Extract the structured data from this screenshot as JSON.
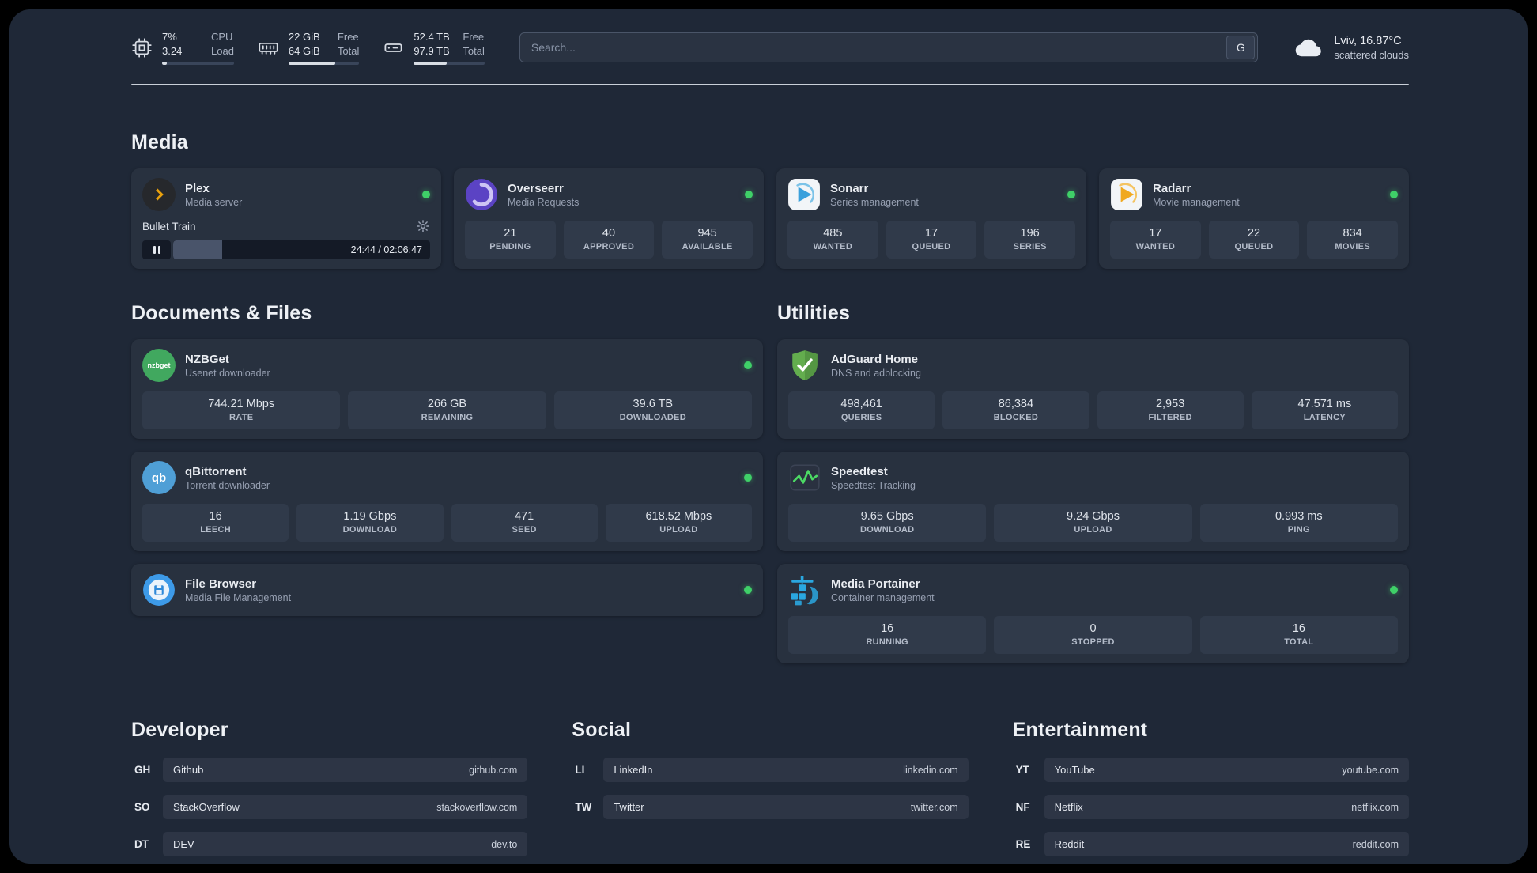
{
  "colors": {
    "status_online": "#3fd068",
    "accent_plex": "#e8a00d",
    "accent_sonarr": "#3aa0dc",
    "accent_radarr": "#f0a91f",
    "accent_adguard": "#63ad4e",
    "accent_speedtest": "#4cd964",
    "accent_portainer": "#2aa7e0"
  },
  "topbar": {
    "cpu": {
      "usage": "7%",
      "load": "3.24",
      "label_line1": "CPU",
      "label_line2": "Load",
      "percent": 7
    },
    "ram": {
      "free": "22 GiB",
      "total": "64 GiB",
      "label_line1": "Free",
      "label_line2": "Total",
      "percent": 66
    },
    "disk": {
      "free": "52.4 TB",
      "total": "97.9 TB",
      "label_line1": "Free",
      "label_line2": "Total",
      "percent": 47
    },
    "search": {
      "placeholder": "Search...",
      "button_label": "G"
    },
    "weather": {
      "location": "Lviv, 16.87°C",
      "condition": "scattered clouds"
    }
  },
  "media": {
    "section_title": "Media",
    "plex": {
      "title": "Plex",
      "subtitle": "Media server",
      "now_playing": "Bullet Train",
      "time_display": "24:44 / 02:06:47",
      "progress_percent": 19
    },
    "overseerr": {
      "title": "Overseerr",
      "subtitle": "Media Requests",
      "stats": [
        {
          "value": "21",
          "label": "PENDING"
        },
        {
          "value": "40",
          "label": "APPROVED"
        },
        {
          "value": "945",
          "label": "AVAILABLE"
        }
      ]
    },
    "sonarr": {
      "title": "Sonarr",
      "subtitle": "Series management",
      "stats": [
        {
          "value": "485",
          "label": "WANTED"
        },
        {
          "value": "17",
          "label": "QUEUED"
        },
        {
          "value": "196",
          "label": "SERIES"
        }
      ]
    },
    "radarr": {
      "title": "Radarr",
      "subtitle": "Movie management",
      "stats": [
        {
          "value": "17",
          "label": "WANTED"
        },
        {
          "value": "22",
          "label": "QUEUED"
        },
        {
          "value": "834",
          "label": "MOVIES"
        }
      ]
    }
  },
  "documents": {
    "section_title": "Documents & Files",
    "nzbget": {
      "title": "NZBGet",
      "subtitle": "Usenet downloader",
      "icon_text": "nzbget",
      "stats": [
        {
          "value": "744.21 Mbps",
          "label": "RATE"
        },
        {
          "value": "266 GB",
          "label": "REMAINING"
        },
        {
          "value": "39.6 TB",
          "label": "DOWNLOADED"
        }
      ]
    },
    "qbittorrent": {
      "title": "qBittorrent",
      "subtitle": "Torrent downloader",
      "icon_text": "qb",
      "stats": [
        {
          "value": "16",
          "label": "LEECH"
        },
        {
          "value": "1.19 Gbps",
          "label": "DOWNLOAD"
        },
        {
          "value": "471",
          "label": "SEED"
        },
        {
          "value": "618.52 Mbps",
          "label": "UPLOAD"
        }
      ]
    },
    "filebrowser": {
      "title": "File Browser",
      "subtitle": "Media File Management"
    }
  },
  "utilities": {
    "section_title": "Utilities",
    "adguard": {
      "title": "AdGuard Home",
      "subtitle": "DNS and adblocking",
      "stats": [
        {
          "value": "498,461",
          "label": "QUERIES"
        },
        {
          "value": "86,384",
          "label": "BLOCKED"
        },
        {
          "value": "2,953",
          "label": "FILTERED"
        },
        {
          "value": "47.571 ms",
          "label": "LATENCY"
        }
      ]
    },
    "speedtest": {
      "title": "Speedtest",
      "subtitle": "Speedtest Tracking",
      "stats": [
        {
          "value": "9.65 Gbps",
          "label": "DOWNLOAD"
        },
        {
          "value": "9.24 Gbps",
          "label": "UPLOAD"
        },
        {
          "value": "0.993 ms",
          "label": "PING"
        }
      ]
    },
    "portainer": {
      "title": "Media Portainer",
      "subtitle": "Container management",
      "stats": [
        {
          "value": "16",
          "label": "RUNNING"
        },
        {
          "value": "0",
          "label": "STOPPED"
        },
        {
          "value": "16",
          "label": "TOTAL"
        }
      ]
    }
  },
  "bookmarks": {
    "developer": {
      "section_title": "Developer",
      "items": [
        {
          "abbr": "GH",
          "name": "Github",
          "url": "github.com"
        },
        {
          "abbr": "SO",
          "name": "StackOverflow",
          "url": "stackoverflow.com"
        },
        {
          "abbr": "DT",
          "name": "DEV",
          "url": "dev.to"
        }
      ]
    },
    "social": {
      "section_title": "Social",
      "items": [
        {
          "abbr": "LI",
          "name": "LinkedIn",
          "url": "linkedin.com"
        },
        {
          "abbr": "TW",
          "name": "Twitter",
          "url": "twitter.com"
        }
      ]
    },
    "entertainment": {
      "section_title": "Entertainment",
      "items": [
        {
          "abbr": "YT",
          "name": "YouTube",
          "url": "youtube.com"
        },
        {
          "abbr": "NF",
          "name": "Netflix",
          "url": "netflix.com"
        },
        {
          "abbr": "RE",
          "name": "Reddit",
          "url": "reddit.com"
        }
      ]
    }
  }
}
